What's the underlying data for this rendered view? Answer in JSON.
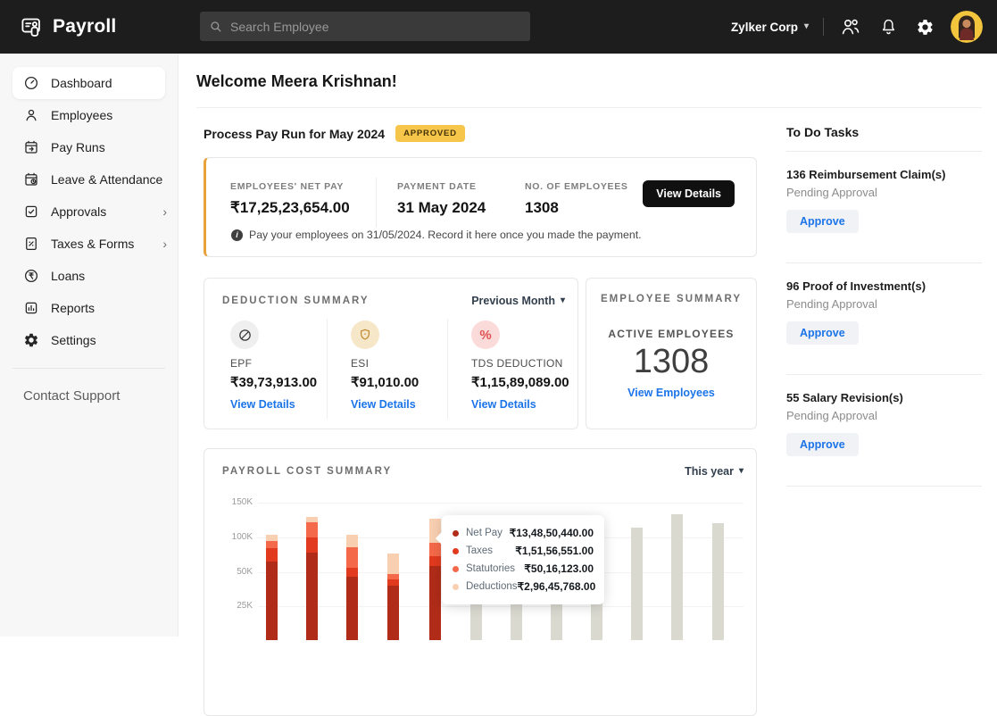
{
  "colors": {
    "topbar_bg": "#1d1d1d",
    "sidebar_bg": "#f7f7f7",
    "link_blue": "#1b74e8",
    "amber_accent": "#e9a23b",
    "badge_bg": "#f6c64a",
    "badge_text": "#453309",
    "black_button": "#101010",
    "approve_bg": "#f0f2f5"
  },
  "icons": {
    "caret-down": "▾",
    "chevron-right": "›",
    "info": "i",
    "percent": "%"
  },
  "topbar": {
    "app_name": "Payroll",
    "search_placeholder": "Search Employee",
    "org_name": "Zylker Corp"
  },
  "sidebar": {
    "items": [
      {
        "label": "Dashboard",
        "icon": "dashboard-icon",
        "active": true
      },
      {
        "label": "Employees",
        "icon": "employees-icon"
      },
      {
        "label": "Pay Runs",
        "icon": "pay-runs-icon"
      },
      {
        "label": "Leave & Attendance",
        "icon": "leave-attendance-icon"
      },
      {
        "label": "Approvals",
        "icon": "approvals-icon",
        "has_submenu": true
      },
      {
        "label": "Taxes & Forms",
        "icon": "taxes-forms-icon",
        "has_submenu": true
      },
      {
        "label": "Loans",
        "icon": "loans-icon"
      },
      {
        "label": "Reports",
        "icon": "reports-icon"
      },
      {
        "label": "Settings",
        "icon": "settings-icon"
      }
    ],
    "contact_support": "Contact Support"
  },
  "page": {
    "welcome_title": "Welcome Meera Krishnan!"
  },
  "payrun": {
    "section_title": "Process Pay Run for May 2024",
    "status_badge": "APPROVED",
    "stats": [
      {
        "label": "EMPLOYEES' NET PAY",
        "value": "₹17,25,23,654.00"
      },
      {
        "label": "PAYMENT DATE",
        "value": "31 May 2024"
      },
      {
        "label": "NO. OF EMPLOYEES",
        "value": "1308"
      }
    ],
    "view_details_label": "View Details",
    "info_note": "Pay your employees on 31/05/2024. Record it here once you made the payment."
  },
  "deduction_summary": {
    "title": "DEDUCTION SUMMARY",
    "period_filter": "Previous Month",
    "items": [
      {
        "label": "EPF",
        "value": "₹39,73,913.00",
        "link": "View Details",
        "icon": "epf-icon"
      },
      {
        "label": "ESI",
        "value": "₹91,010.00",
        "link": "View Details",
        "icon": "esi-icon"
      },
      {
        "label": "TDS DEDUCTION",
        "value": "₹1,15,89,089.00",
        "link": "View Details",
        "icon": "tds-percent-icon"
      }
    ]
  },
  "employee_summary": {
    "title": "EMPLOYEE SUMMARY",
    "label": "ACTIVE EMPLOYEES",
    "count": "1308",
    "link": "View Employees"
  },
  "todo": {
    "title": "To Do Tasks",
    "tasks": [
      {
        "title": "136 Reimbursement Claim(s)",
        "status": "Pending Approval",
        "action": "Approve"
      },
      {
        "title": "96 Proof of Investment(s)",
        "status": "Pending Approval",
        "action": "Approve"
      },
      {
        "title": "55 Salary Revision(s)",
        "status": "Pending Approval",
        "action": "Approve"
      }
    ]
  },
  "chart_data": {
    "type": "bar",
    "stacked": true,
    "title": "PAYROLL COST SUMMARY",
    "period_filter": "This year",
    "y_axis": {
      "unit": "K",
      "ticks": [
        {
          "label": "150K",
          "k": 150
        },
        {
          "label": "100K",
          "k": 100
        },
        {
          "label": "50K",
          "k": 50
        },
        {
          "label": "25K",
          "k": 25
        }
      ]
    },
    "x_labels_visible": false,
    "grid": true,
    "series_names": [
      "Net Pay",
      "Taxes",
      "Statutories",
      "Deductions"
    ],
    "series_colors": {
      "net_pay": "#b02c18",
      "taxes": "#e23a1f",
      "statutories": "#f4694a",
      "deductions": "#f9cfb2",
      "future": "#d9d9d0"
    },
    "processed_months_k_approx": [
      {
        "net_pay": 65,
        "taxes": 20,
        "statutories": 10,
        "deductions": 9
      },
      {
        "net_pay": 78,
        "taxes": 22,
        "statutories": 22,
        "deductions": 7
      },
      {
        "net_pay": 47,
        "taxes": 10,
        "statutories": 29,
        "deductions": 18
      },
      {
        "net_pay": 40,
        "taxes": 5,
        "statutories": 4,
        "deductions": 28
      },
      {
        "net_pay": 59,
        "taxes": 14,
        "statutories": 19,
        "deductions": 35
      }
    ],
    "future_months_total_k_approx": [
      100,
      100,
      100,
      100,
      114,
      133,
      121
    ],
    "tooltip": {
      "rows": [
        {
          "label": "Net Pay",
          "value": "₹13,48,50,440.00",
          "color": "#b02c18"
        },
        {
          "label": "Taxes",
          "value": "₹1,51,56,551.00",
          "color": "#e23a1f"
        },
        {
          "label": "Statutories",
          "value": "₹50,16,123.00",
          "color": "#f4694a"
        },
        {
          "label": "Deductions",
          "value": "₹2,96,45,768.00",
          "color": "#f9cfb2"
        }
      ]
    }
  }
}
